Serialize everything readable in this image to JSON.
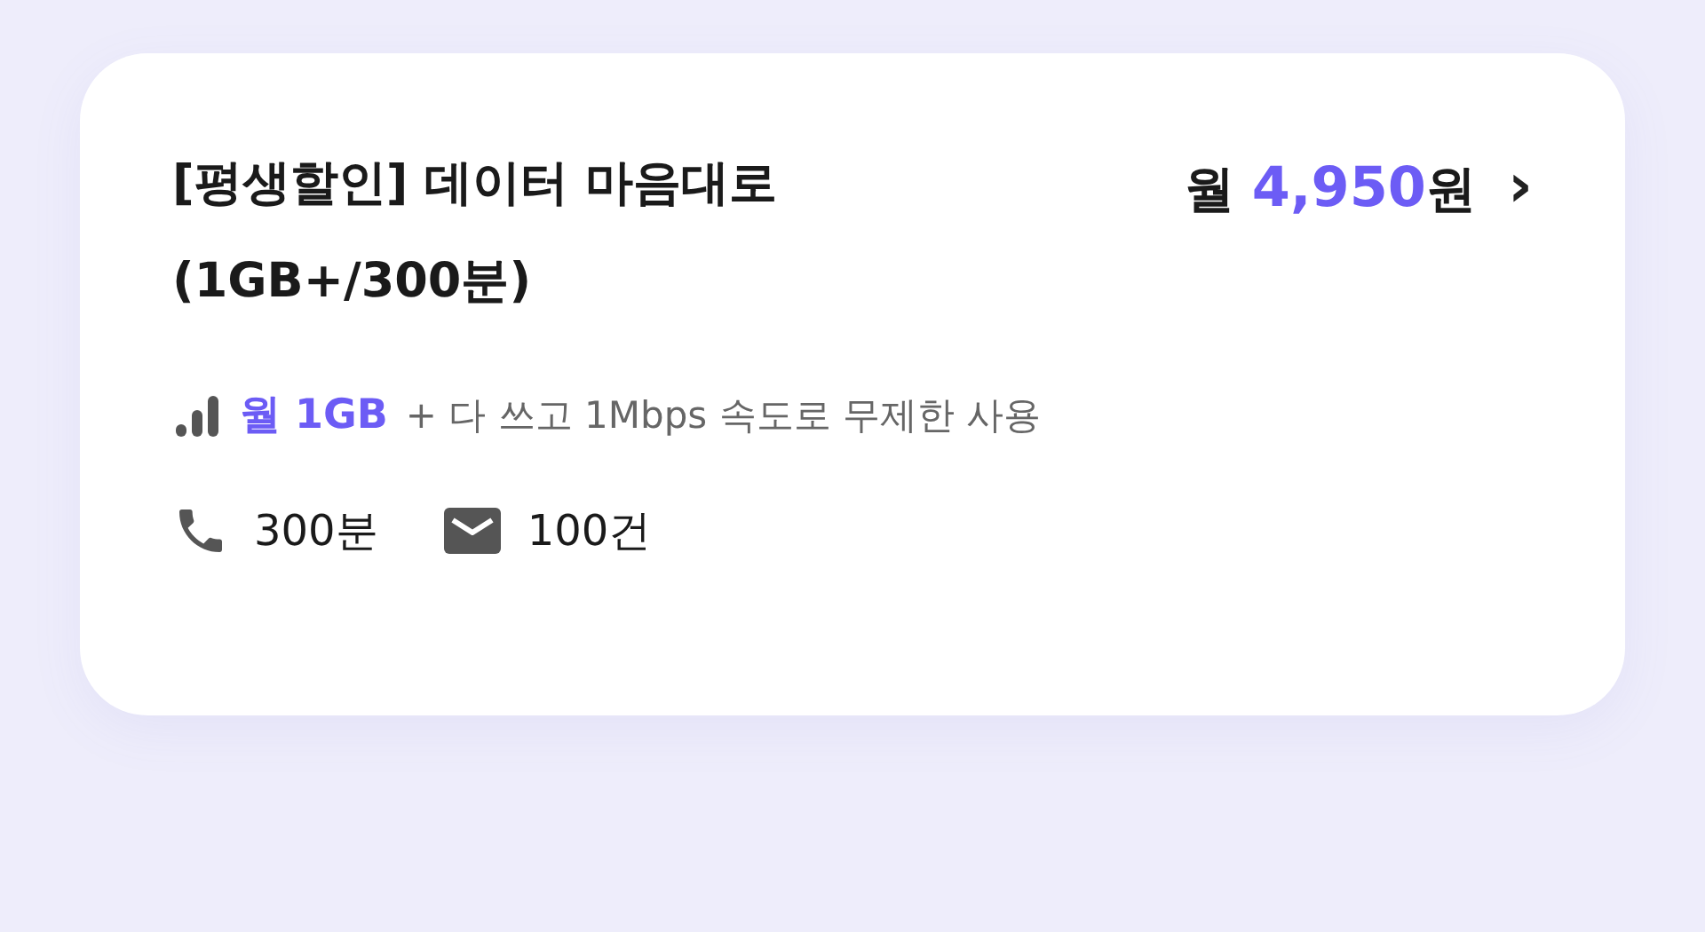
{
  "plan": {
    "title": "[평생할인] 데이터 마음대로 (1GB+/300분)",
    "price": {
      "prefix": "월",
      "amount": "4,950",
      "unit": "원"
    },
    "chevron": "›",
    "data": {
      "amount": "월 1GB",
      "note": "+ 다 쓰고 1Mbps 속도로 무제한 사용"
    },
    "features": [
      {
        "kind": "call",
        "text": "300분"
      },
      {
        "kind": "message",
        "text": "100건"
      }
    ]
  }
}
